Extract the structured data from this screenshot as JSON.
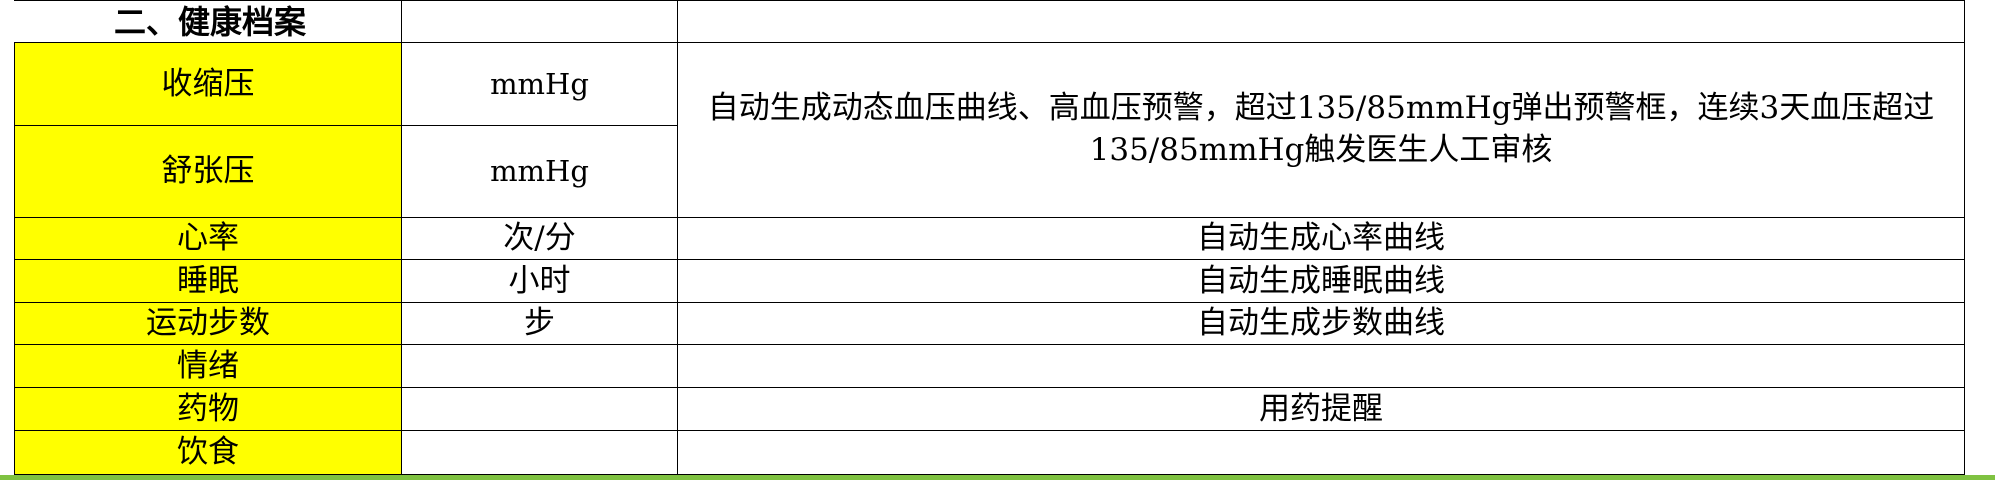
{
  "sheet": {
    "section_title": "二、健康档案",
    "rows": [
      {
        "item": "收缩压",
        "unit": "mmHg"
      },
      {
        "item": "舒张压",
        "unit": "mmHg"
      },
      {
        "item": "心率",
        "unit": "次/分",
        "description": "自动生成心率曲线"
      },
      {
        "item": "睡眠",
        "unit": "小时",
        "description": "自动生成睡眠曲线"
      },
      {
        "item": "运动步数",
        "unit": "步",
        "description": "自动生成步数曲线"
      },
      {
        "item": "情绪",
        "unit": "",
        "description": ""
      },
      {
        "item": "药物",
        "unit": "",
        "description": "用药提醒"
      },
      {
        "item": "饮食",
        "unit": "",
        "description": ""
      }
    ],
    "blood_pressure_description": "自动生成动态血压曲线、高血压预警，超过135/85mmHg弹出预警框，连续3天血压超过135/85mmHg触发医生人工审核"
  },
  "colors": {
    "item_fill": "#ffff00",
    "grid_line": "#000000",
    "bottom_strip": "#7fc241"
  }
}
